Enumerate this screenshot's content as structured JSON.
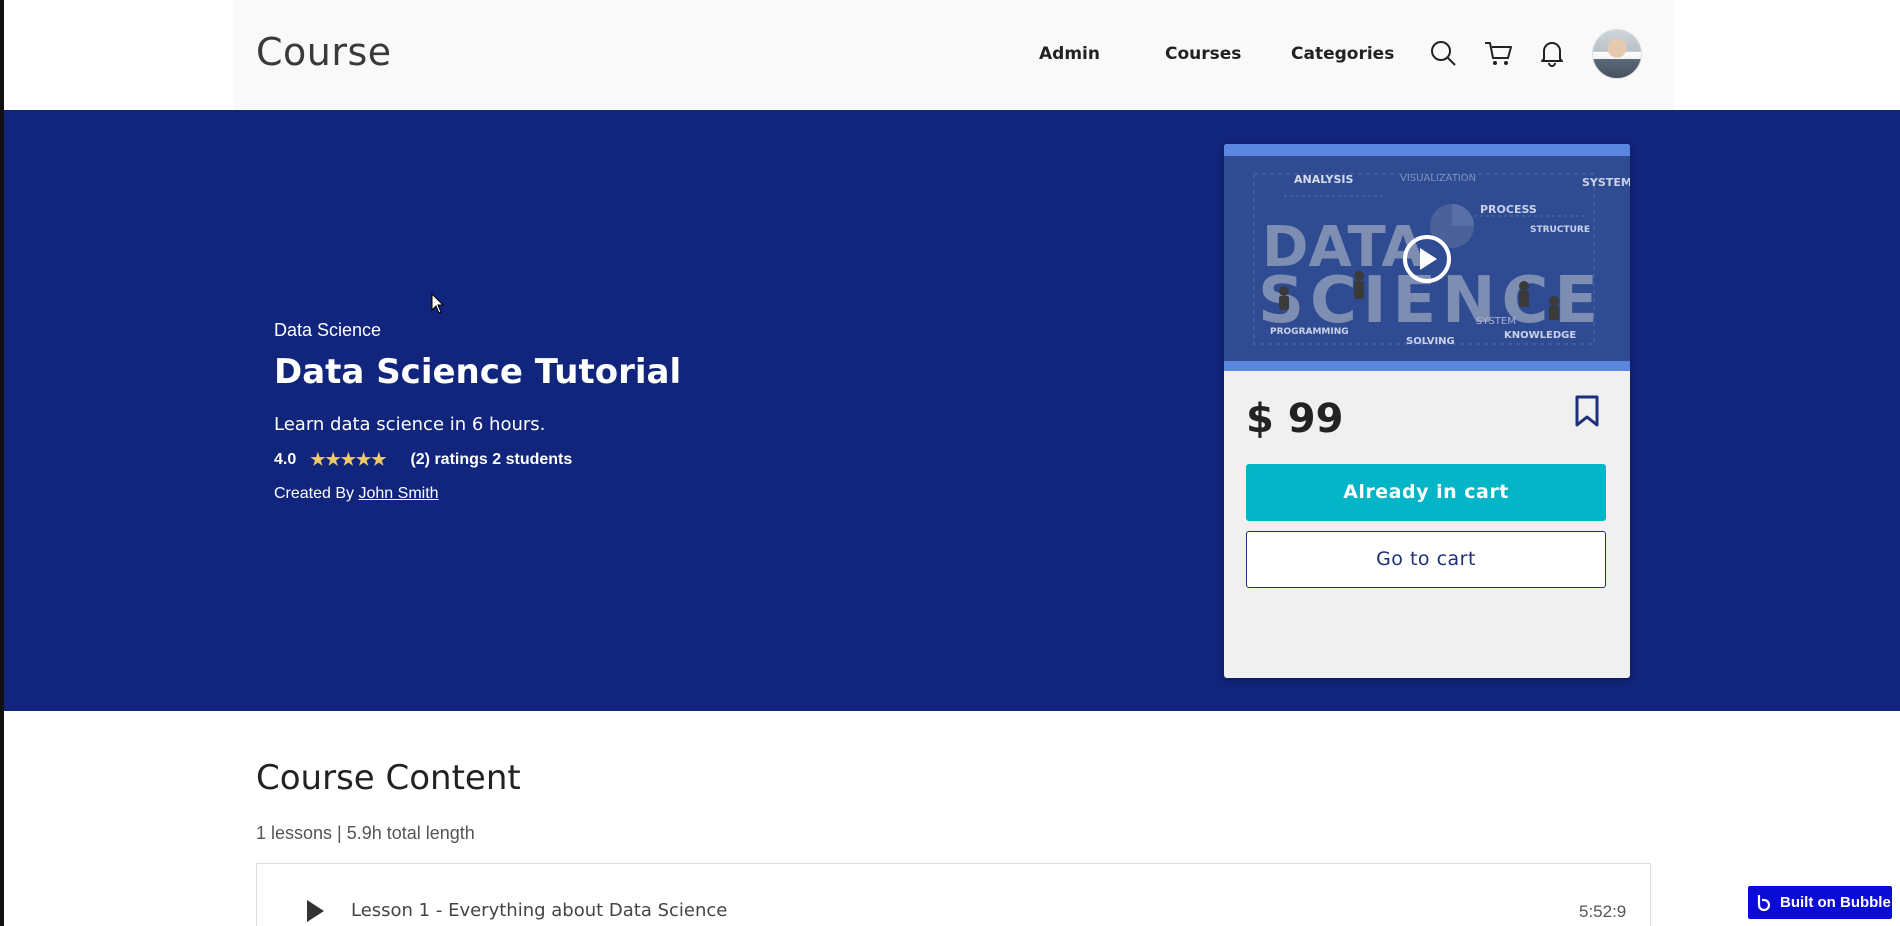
{
  "header": {
    "logo": "Course",
    "nav": [
      "Admin",
      "Courses",
      "Categories"
    ],
    "icons": [
      "search-icon",
      "cart-icon",
      "bell-icon"
    ],
    "avatar": "user-avatar"
  },
  "hero": {
    "category": "Data Science",
    "title": "Data Science Tutorial",
    "subtitle": "Learn data science in 6 hours.",
    "rating": "4.0",
    "stars": "★★★★★",
    "rating_count": "(2) ratings 2 students",
    "created_prefix": "Created By",
    "author": "John Smith",
    "background": "#10257b"
  },
  "card": {
    "preview_words": {
      "analysis": "ANALYSIS",
      "visualization": "VISUALIZATION",
      "system": "SYSTEM",
      "process": "PROCESS",
      "structure": "STRUCTURE",
      "data": "DATA",
      "science": "SCIENCE",
      "programming": "PROGRAMMING",
      "solving": "SOLVING",
      "knowledge": "KNOWLEDGE",
      "system2": "SYSTEM"
    },
    "price": "$ 99",
    "btn_cart": "Already in cart",
    "btn_goto": "Go to cart",
    "accent": "#03b5c6"
  },
  "content": {
    "title": "Course Content",
    "meta": "1 lessons | 5.9h total length",
    "lessons": [
      {
        "title": "Lesson 1 - Everything about Data Science",
        "duration": "5:52:9"
      }
    ]
  },
  "badge": {
    "label": "Built on Bubble"
  }
}
